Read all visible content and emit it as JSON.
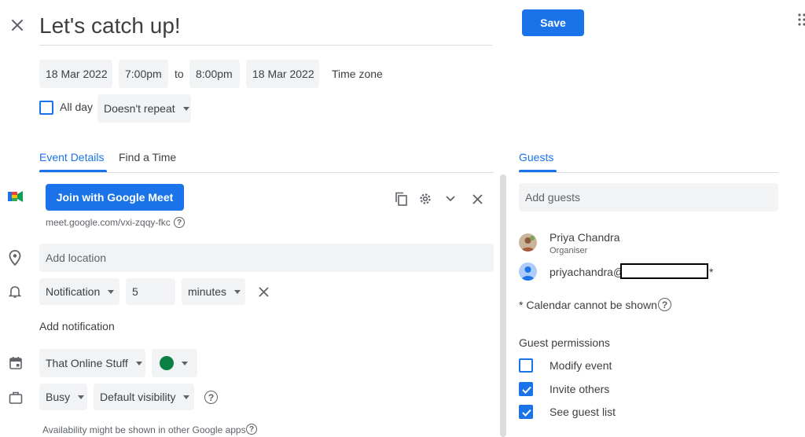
{
  "header": {
    "title": "Let's catch up!",
    "save_label": "Save"
  },
  "datetime": {
    "start_date": "18 Mar 2022",
    "start_time": "7:00pm",
    "to_label": "to",
    "end_time": "8:00pm",
    "end_date": "18 Mar 2022",
    "timezone_label": "Time zone",
    "allday_label": "All day",
    "repeat_label": "Doesn't repeat"
  },
  "tabs": {
    "event_details": "Event Details",
    "find_time": "Find a Time",
    "guests": "Guests"
  },
  "meet": {
    "button_label": "Join with Google Meet",
    "link": "meet.google.com/vxi-zqqy-fkc"
  },
  "location": {
    "placeholder": "Add location"
  },
  "notification": {
    "type": "Notification",
    "value": "5",
    "unit": "minutes",
    "add_label": "Add notification"
  },
  "calendar": {
    "name": "That Online Stuff",
    "color": "#0b8043"
  },
  "availability": {
    "status": "Busy",
    "visibility": "Default visibility",
    "note": "Availability might be shown in other Google apps"
  },
  "guests": {
    "add_placeholder": "Add guests",
    "list": [
      {
        "name": "Priya Chandra",
        "role": "Organiser"
      },
      {
        "name": "priyachandra@",
        "suffix": "*"
      }
    ],
    "calendar_note": "* Calendar cannot be shown"
  },
  "permissions": {
    "title": "Guest permissions",
    "items": [
      {
        "label": "Modify event",
        "checked": false
      },
      {
        "label": "Invite others",
        "checked": true
      },
      {
        "label": "See guest list",
        "checked": true
      }
    ]
  },
  "colors": {
    "accent": "#1a73e8",
    "field_bg": "#f1f3f4"
  }
}
